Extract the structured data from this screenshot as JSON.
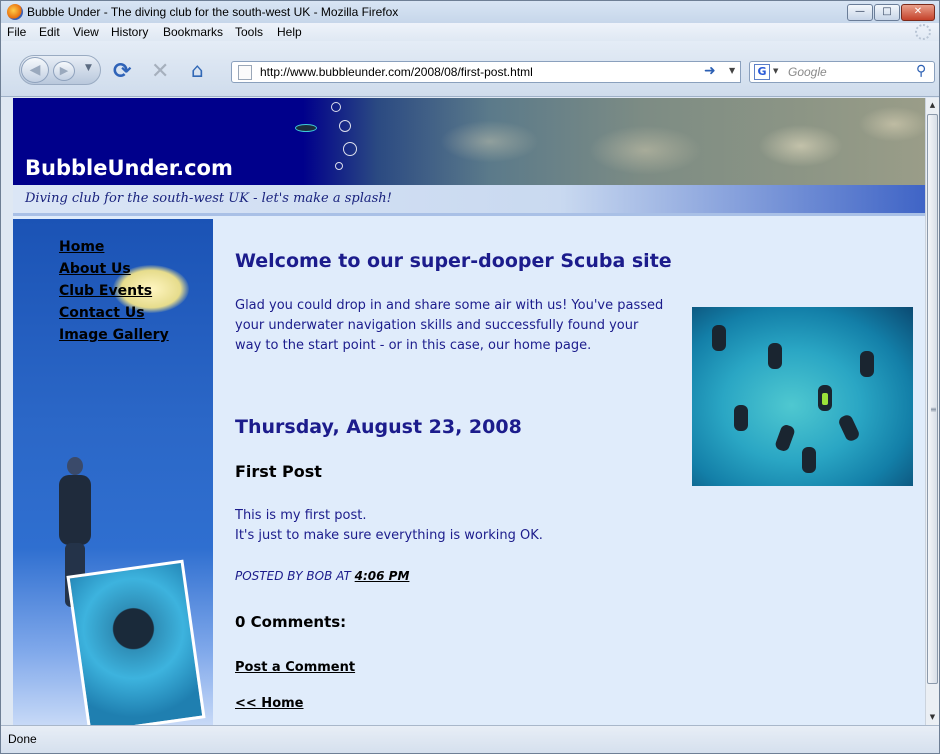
{
  "browser": {
    "title": "Bubble Under - The diving club for the south-west UK - Mozilla Firefox",
    "menu": [
      "File",
      "Edit",
      "View",
      "History",
      "Bookmarks",
      "Tools",
      "Help"
    ],
    "url": "http://www.bubbleunder.com/2008/08/first-post.html",
    "search_placeholder": "Google",
    "status": "Done",
    "icons": {
      "window": "firefox-icon",
      "back": "back-arrow-icon",
      "forward": "forward-arrow-icon",
      "reload": "reload-icon",
      "stop": "stop-icon",
      "home": "home-icon",
      "go": "go-arrow-icon",
      "search": "magnifier-icon"
    }
  },
  "site": {
    "logo": "BubbleUnder.com",
    "tagline": "Diving club for the south-west UK - let's make a splash!",
    "nav": [
      "Home",
      "About Us",
      "Club Events",
      "Contact Us",
      "Image Gallery"
    ],
    "welcome_heading": "Welcome to our super-dooper Scuba site",
    "intro": "Glad you could drop in and share some air with us! You've passed your underwater navigation skills and successfully found your way to the start point - or in this case, our home page.",
    "date_header": "Thursday, August 23, 2008",
    "post": {
      "title": "First Post",
      "body_line1": "This is my first post.",
      "body_line2": "It's just to make sure everything is working OK.",
      "posted_by": "POSTED BY BOB AT",
      "time": "4:06 PM"
    },
    "comments_heading": "0 Comments:",
    "post_comment_link": "Post a Comment",
    "home_link": "<< Home"
  },
  "colors": {
    "header_bg": "#00008b",
    "content_bg": "#e0ecfb",
    "text_blue": "#1c1c8c"
  }
}
